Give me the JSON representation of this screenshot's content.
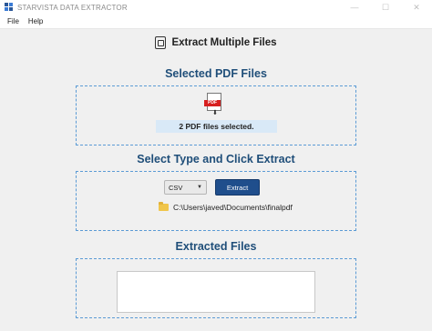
{
  "window": {
    "title": "STARVISTA DATA EXTRACTOR",
    "icon": "app-logo-icon",
    "controls": {
      "minimize": "—",
      "maximize": "☐",
      "close": "✕"
    }
  },
  "menu": {
    "items": [
      "File",
      "Help"
    ]
  },
  "header": {
    "title": "Extract Multiple Files",
    "icon": "pdf-files-icon"
  },
  "sections": {
    "selected": {
      "title": "Selected PDF Files",
      "pdf_icon_label": "PDF",
      "status": "2 PDF files selected."
    },
    "extract": {
      "title": "Select Type and Click Extract",
      "format_value": "CSV",
      "button_label": "Extract",
      "output_path": "C:\\Users\\javed\\Documents\\finalpdf"
    },
    "extracted": {
      "title": "Extracted Files",
      "content": ""
    }
  },
  "colors": {
    "section_title": "#1f4e79",
    "dash_border": "#5b9bd5",
    "button": "#1f4e8c",
    "status_bg": "#d9e9f7",
    "pdf_red": "#d71f1f"
  }
}
